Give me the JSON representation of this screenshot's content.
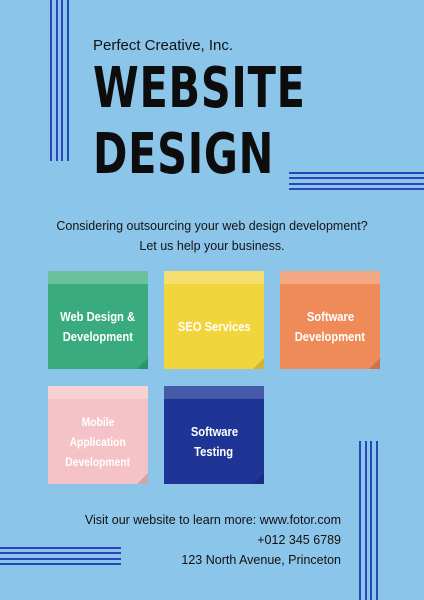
{
  "company": "Perfect Creative, Inc.",
  "title": {
    "line1": "WEBSITE",
    "line2": "DESIGN"
  },
  "intro": {
    "line1": "Considering outsourcing your web design development?",
    "line2": "Let us help your business."
  },
  "colors": {
    "background": "#8cc5ea",
    "stripes": "#2947b8",
    "green": "#3aab7e",
    "yellow": "#f2d43d",
    "orange": "#ef8a59",
    "pink": "#f5c2c7",
    "navy": "#1f3596"
  },
  "services": [
    {
      "lines": [
        "Web Design &",
        "Development"
      ],
      "color": "green"
    },
    {
      "lines": [
        "SEO Services"
      ],
      "color": "yellow"
    },
    {
      "lines": [
        "Software",
        "Development"
      ],
      "color": "orange"
    },
    {
      "lines": [
        "Mobile",
        "Application",
        "Development"
      ],
      "color": "pink"
    },
    {
      "lines": [
        "Software",
        "Testing"
      ],
      "color": "navy"
    }
  ],
  "contact": {
    "website_line": "Visit our website to learn more: www.fotor.com",
    "phone": "+012 345 6789",
    "address": "123 North Avenue, Princeton"
  }
}
